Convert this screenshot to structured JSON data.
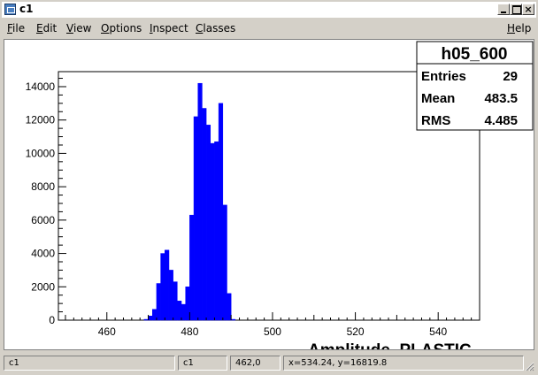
{
  "window": {
    "title": "c1"
  },
  "menu": {
    "file": {
      "first": "F",
      "rest": "ile"
    },
    "edit": {
      "first": "E",
      "rest": "dit"
    },
    "view": {
      "first": "V",
      "rest": "iew"
    },
    "options": {
      "first": "O",
      "rest": "ptions"
    },
    "inspect": {
      "first": "I",
      "rest": "nspect"
    },
    "classes": {
      "first": "C",
      "rest": "lasses"
    },
    "help": {
      "first": "H",
      "rest": "elp"
    }
  },
  "stats": {
    "name": "h05_600",
    "rows": [
      {
        "label": "Entries",
        "value": "29"
      },
      {
        "label": "Mean",
        "value": "483.5"
      },
      {
        "label": "RMS",
        "value": "4.485"
      }
    ]
  },
  "status": {
    "canvas_name": "c1",
    "object_name": "c1",
    "pixel": "462,0",
    "coords": "x=534.24, y=16819.8"
  },
  "chart_data": {
    "type": "bar",
    "title": "",
    "xlabel": "Amplitude_PLASTIC",
    "ylabel": "",
    "xlim": [
      448.3,
      550
    ],
    "ylim": [
      0,
      14900
    ],
    "bin_width": 1,
    "x_ticks": [
      "460",
      "480",
      "500",
      "520",
      "540"
    ],
    "y_ticks": [
      "0",
      "2000",
      "4000",
      "6000",
      "8000",
      "10000",
      "12000",
      "14000"
    ],
    "color": "#0000ff",
    "x": [
      469,
      470,
      471,
      472,
      473,
      474,
      475,
      476,
      477,
      478,
      479,
      480,
      481,
      482,
      483,
      484,
      485,
      486,
      487,
      488,
      489,
      490
    ],
    "values": [
      50,
      250,
      650,
      2200,
      4000,
      4200,
      3000,
      2300,
      1150,
      950,
      2000,
      6300,
      12200,
      14200,
      12700,
      11700,
      10600,
      10700,
      13000,
      6900,
      1600,
      50
    ]
  }
}
